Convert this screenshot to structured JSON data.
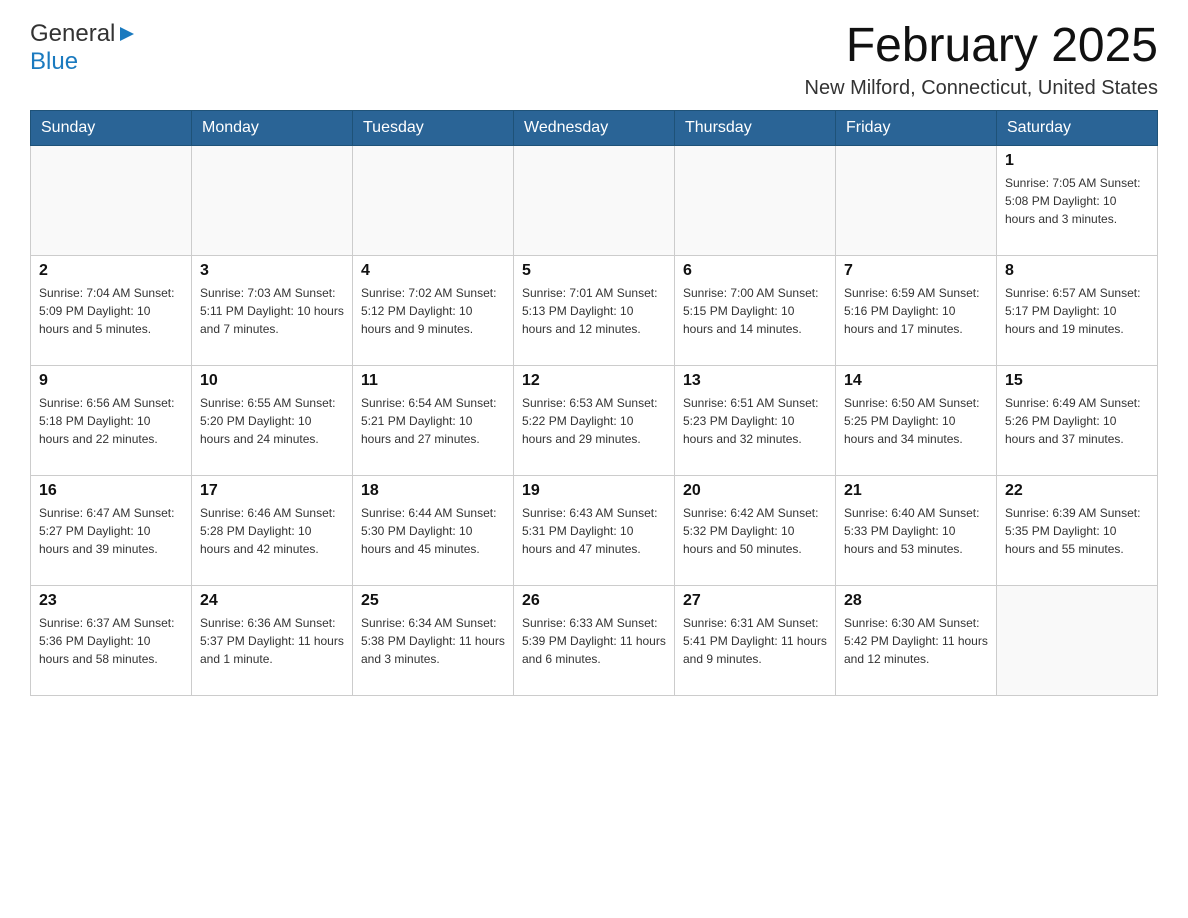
{
  "header": {
    "logo_general": "General",
    "logo_blue": "Blue",
    "month_title": "February 2025",
    "location": "New Milford, Connecticut, United States"
  },
  "weekdays": [
    "Sunday",
    "Monday",
    "Tuesday",
    "Wednesday",
    "Thursday",
    "Friday",
    "Saturday"
  ],
  "weeks": [
    [
      {
        "day": "",
        "info": ""
      },
      {
        "day": "",
        "info": ""
      },
      {
        "day": "",
        "info": ""
      },
      {
        "day": "",
        "info": ""
      },
      {
        "day": "",
        "info": ""
      },
      {
        "day": "",
        "info": ""
      },
      {
        "day": "1",
        "info": "Sunrise: 7:05 AM\nSunset: 5:08 PM\nDaylight: 10 hours and 3 minutes."
      }
    ],
    [
      {
        "day": "2",
        "info": "Sunrise: 7:04 AM\nSunset: 5:09 PM\nDaylight: 10 hours and 5 minutes."
      },
      {
        "day": "3",
        "info": "Sunrise: 7:03 AM\nSunset: 5:11 PM\nDaylight: 10 hours and 7 minutes."
      },
      {
        "day": "4",
        "info": "Sunrise: 7:02 AM\nSunset: 5:12 PM\nDaylight: 10 hours and 9 minutes."
      },
      {
        "day": "5",
        "info": "Sunrise: 7:01 AM\nSunset: 5:13 PM\nDaylight: 10 hours and 12 minutes."
      },
      {
        "day": "6",
        "info": "Sunrise: 7:00 AM\nSunset: 5:15 PM\nDaylight: 10 hours and 14 minutes."
      },
      {
        "day": "7",
        "info": "Sunrise: 6:59 AM\nSunset: 5:16 PM\nDaylight: 10 hours and 17 minutes."
      },
      {
        "day": "8",
        "info": "Sunrise: 6:57 AM\nSunset: 5:17 PM\nDaylight: 10 hours and 19 minutes."
      }
    ],
    [
      {
        "day": "9",
        "info": "Sunrise: 6:56 AM\nSunset: 5:18 PM\nDaylight: 10 hours and 22 minutes."
      },
      {
        "day": "10",
        "info": "Sunrise: 6:55 AM\nSunset: 5:20 PM\nDaylight: 10 hours and 24 minutes."
      },
      {
        "day": "11",
        "info": "Sunrise: 6:54 AM\nSunset: 5:21 PM\nDaylight: 10 hours and 27 minutes."
      },
      {
        "day": "12",
        "info": "Sunrise: 6:53 AM\nSunset: 5:22 PM\nDaylight: 10 hours and 29 minutes."
      },
      {
        "day": "13",
        "info": "Sunrise: 6:51 AM\nSunset: 5:23 PM\nDaylight: 10 hours and 32 minutes."
      },
      {
        "day": "14",
        "info": "Sunrise: 6:50 AM\nSunset: 5:25 PM\nDaylight: 10 hours and 34 minutes."
      },
      {
        "day": "15",
        "info": "Sunrise: 6:49 AM\nSunset: 5:26 PM\nDaylight: 10 hours and 37 minutes."
      }
    ],
    [
      {
        "day": "16",
        "info": "Sunrise: 6:47 AM\nSunset: 5:27 PM\nDaylight: 10 hours and 39 minutes."
      },
      {
        "day": "17",
        "info": "Sunrise: 6:46 AM\nSunset: 5:28 PM\nDaylight: 10 hours and 42 minutes."
      },
      {
        "day": "18",
        "info": "Sunrise: 6:44 AM\nSunset: 5:30 PM\nDaylight: 10 hours and 45 minutes."
      },
      {
        "day": "19",
        "info": "Sunrise: 6:43 AM\nSunset: 5:31 PM\nDaylight: 10 hours and 47 minutes."
      },
      {
        "day": "20",
        "info": "Sunrise: 6:42 AM\nSunset: 5:32 PM\nDaylight: 10 hours and 50 minutes."
      },
      {
        "day": "21",
        "info": "Sunrise: 6:40 AM\nSunset: 5:33 PM\nDaylight: 10 hours and 53 minutes."
      },
      {
        "day": "22",
        "info": "Sunrise: 6:39 AM\nSunset: 5:35 PM\nDaylight: 10 hours and 55 minutes."
      }
    ],
    [
      {
        "day": "23",
        "info": "Sunrise: 6:37 AM\nSunset: 5:36 PM\nDaylight: 10 hours and 58 minutes."
      },
      {
        "day": "24",
        "info": "Sunrise: 6:36 AM\nSunset: 5:37 PM\nDaylight: 11 hours and 1 minute."
      },
      {
        "day": "25",
        "info": "Sunrise: 6:34 AM\nSunset: 5:38 PM\nDaylight: 11 hours and 3 minutes."
      },
      {
        "day": "26",
        "info": "Sunrise: 6:33 AM\nSunset: 5:39 PM\nDaylight: 11 hours and 6 minutes."
      },
      {
        "day": "27",
        "info": "Sunrise: 6:31 AM\nSunset: 5:41 PM\nDaylight: 11 hours and 9 minutes."
      },
      {
        "day": "28",
        "info": "Sunrise: 6:30 AM\nSunset: 5:42 PM\nDaylight: 11 hours and 12 minutes."
      },
      {
        "day": "",
        "info": ""
      }
    ]
  ]
}
